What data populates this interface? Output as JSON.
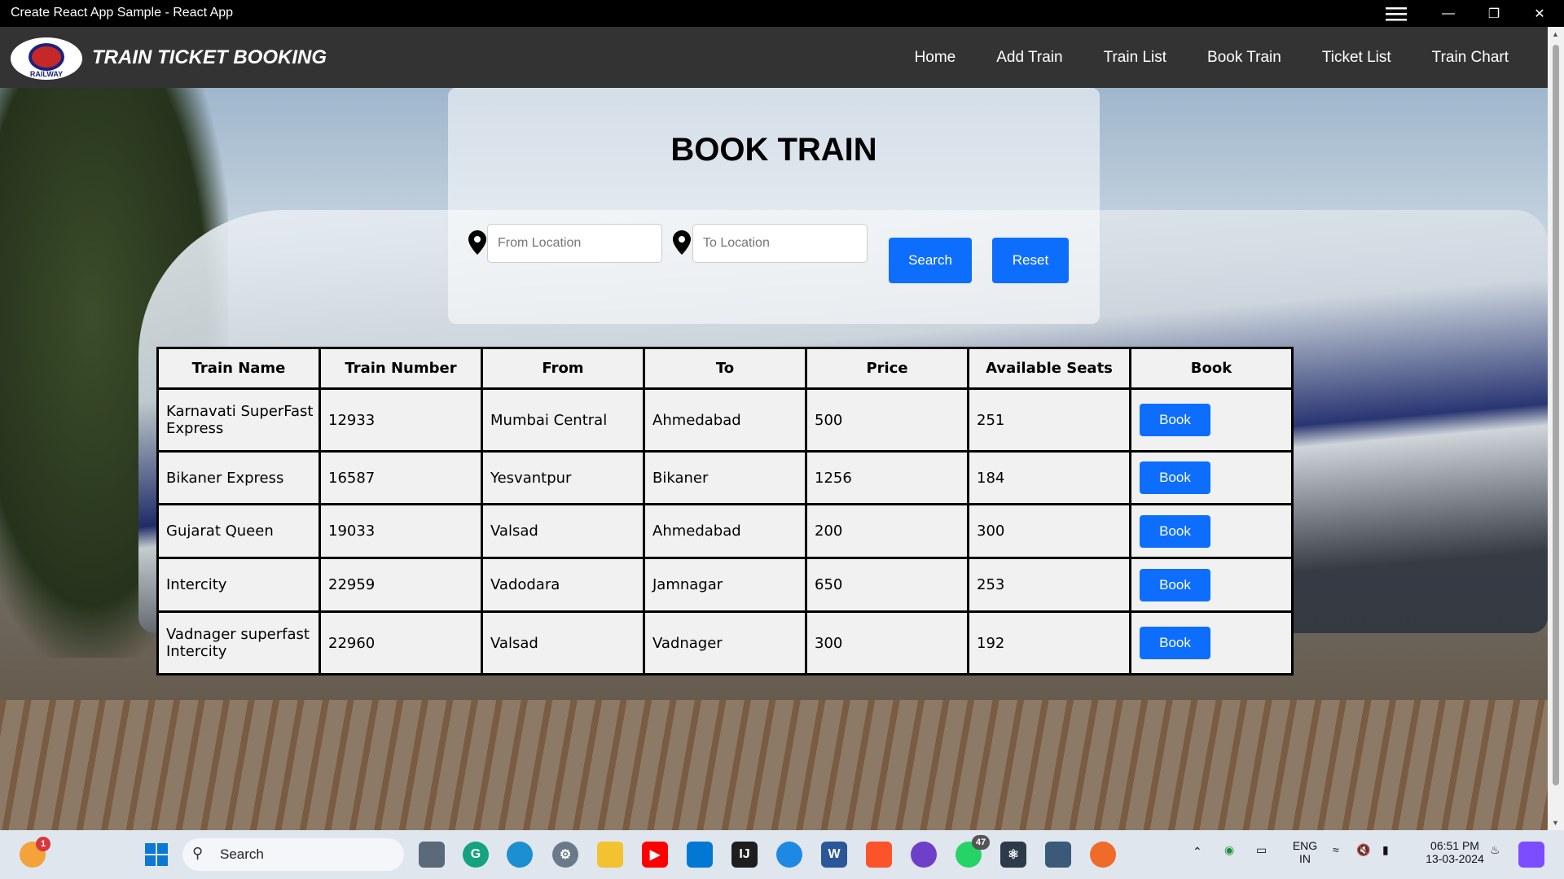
{
  "window": {
    "title": "Create React App Sample - React App"
  },
  "navbar": {
    "logo_text": "RAILWAY",
    "brand": "TRAIN TICKET BOOKING",
    "links": [
      "Home",
      "Add Train",
      "Train List",
      "Book Train",
      "Ticket List",
      "Train Chart"
    ]
  },
  "booking": {
    "heading": "BOOK TRAIN",
    "from_placeholder": "From Location",
    "to_placeholder": "To Location",
    "search_label": "Search",
    "reset_label": "Reset"
  },
  "table": {
    "headers": [
      "Train Name",
      "Train Number",
      "From",
      "To",
      "Price",
      "Available Seats",
      "Book"
    ],
    "book_label": "Book",
    "rows": [
      {
        "name": "Karnavati SuperFast Express",
        "number": "12933",
        "from": "Mumbai Central",
        "to": "Ahmedabad",
        "price": "500",
        "seats": "251"
      },
      {
        "name": "Bikaner Express",
        "number": "16587",
        "from": "Yesvantpur",
        "to": "Bikaner",
        "price": "1256",
        "seats": "184"
      },
      {
        "name": "Gujarat Queen",
        "number": "19033",
        "from": "Valsad",
        "to": "Ahmedabad",
        "price": "200",
        "seats": "300"
      },
      {
        "name": "Intercity",
        "number": "22959",
        "from": "Vadodara",
        "to": "Jamnagar",
        "price": "650",
        "seats": "253"
      },
      {
        "name": "Vadnager superfast Intercity",
        "number": "22960",
        "from": "Valsad",
        "to": "Vadnager",
        "price": "300",
        "seats": "192"
      }
    ]
  },
  "taskbar": {
    "search_label": "Search",
    "notification_badge": "1",
    "whatsapp_badge": "47",
    "language": "ENG",
    "region": "IN",
    "time": "06:51 PM",
    "date": "13-03-2024"
  },
  "colors": {
    "navbar": "#333333",
    "button": "#0d6efd",
    "table_border": "#000000"
  }
}
